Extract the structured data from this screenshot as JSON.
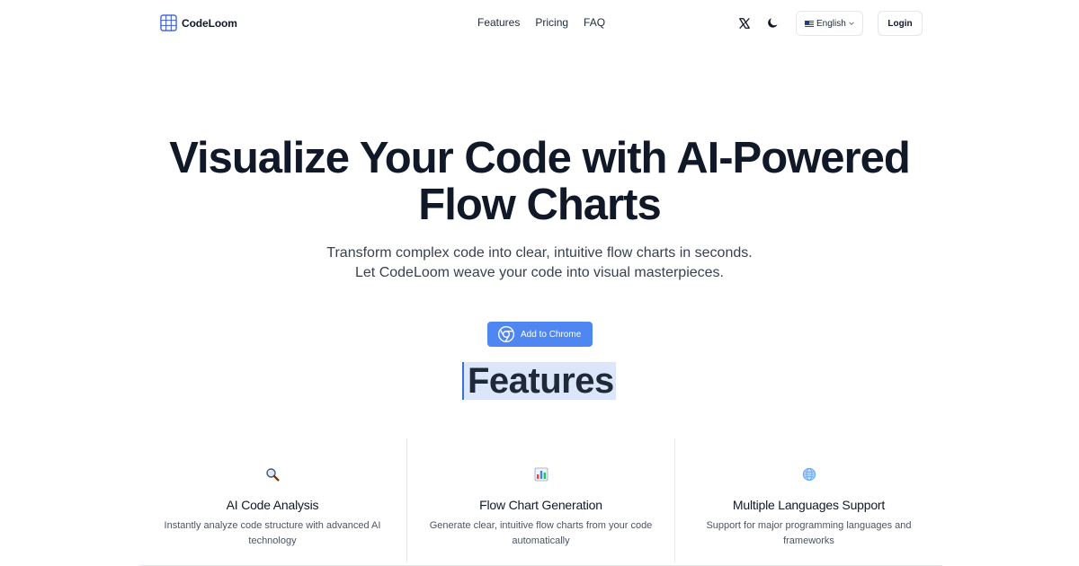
{
  "header": {
    "brand": "CodeLoom",
    "nav": [
      "Features",
      "Pricing",
      "FAQ"
    ],
    "language": "English",
    "login": "Login"
  },
  "hero": {
    "title_line1": "Visualize Your Code with AI-Powered",
    "title_line2": "Flow Charts",
    "subtitle_line1": "Transform complex code into clear, intuitive flow charts in seconds.",
    "subtitle_line2": "Let CodeLoom weave your code into visual masterpieces.",
    "cta": "Add to Chrome"
  },
  "features": {
    "heading": "Features",
    "items": [
      {
        "icon": "magnifier-icon",
        "title": "AI Code Analysis",
        "description": "Instantly analyze code structure with advanced AI technology"
      },
      {
        "icon": "bar-chart-icon",
        "title": "Flow Chart Generation",
        "description": "Generate clear, intuitive flow charts from your code automatically"
      },
      {
        "icon": "globe-icon",
        "title": "Multiple Languages Support",
        "description": "Support for major programming languages and frameworks"
      }
    ]
  },
  "colors": {
    "accent": "#4f87f2",
    "heading": "#111827",
    "highlight": "#dbe6fb"
  }
}
